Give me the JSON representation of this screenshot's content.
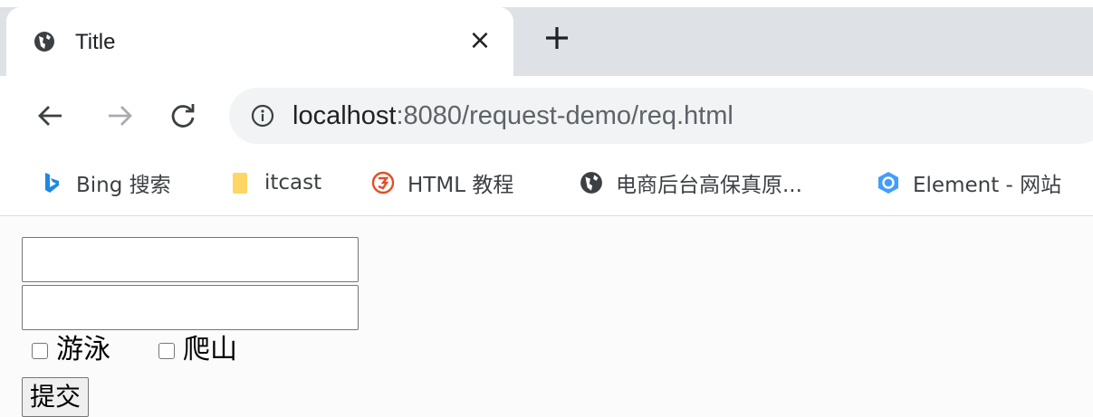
{
  "tab": {
    "title": "Title",
    "close": "×"
  },
  "address": {
    "host": "localhost",
    "rest": ":8080/request-demo/req.html"
  },
  "bookmarks": [
    {
      "label": "Bing 搜索",
      "icon": "bing-icon"
    },
    {
      "label": "itcast",
      "icon": "folder-icon"
    },
    {
      "label": "HTML 教程",
      "icon": "html5-icon"
    },
    {
      "label": "电商后台高保真原...",
      "icon": "globe-icon"
    },
    {
      "label": "Element - 网站",
      "icon": "element-icon"
    }
  ],
  "form": {
    "field1_value": "",
    "field2_value": "",
    "checkbox1_label": "游泳",
    "checkbox2_label": "爬山",
    "submit_label": "提交"
  },
  "colors": {
    "tab_bg": "#dee1e6",
    "omnibox_bg": "#f1f3f4",
    "bing_blue": "#1e88e5",
    "html_red": "#e44d26",
    "folder_yellow": "#fdd663",
    "element_blue": "#409eff"
  }
}
